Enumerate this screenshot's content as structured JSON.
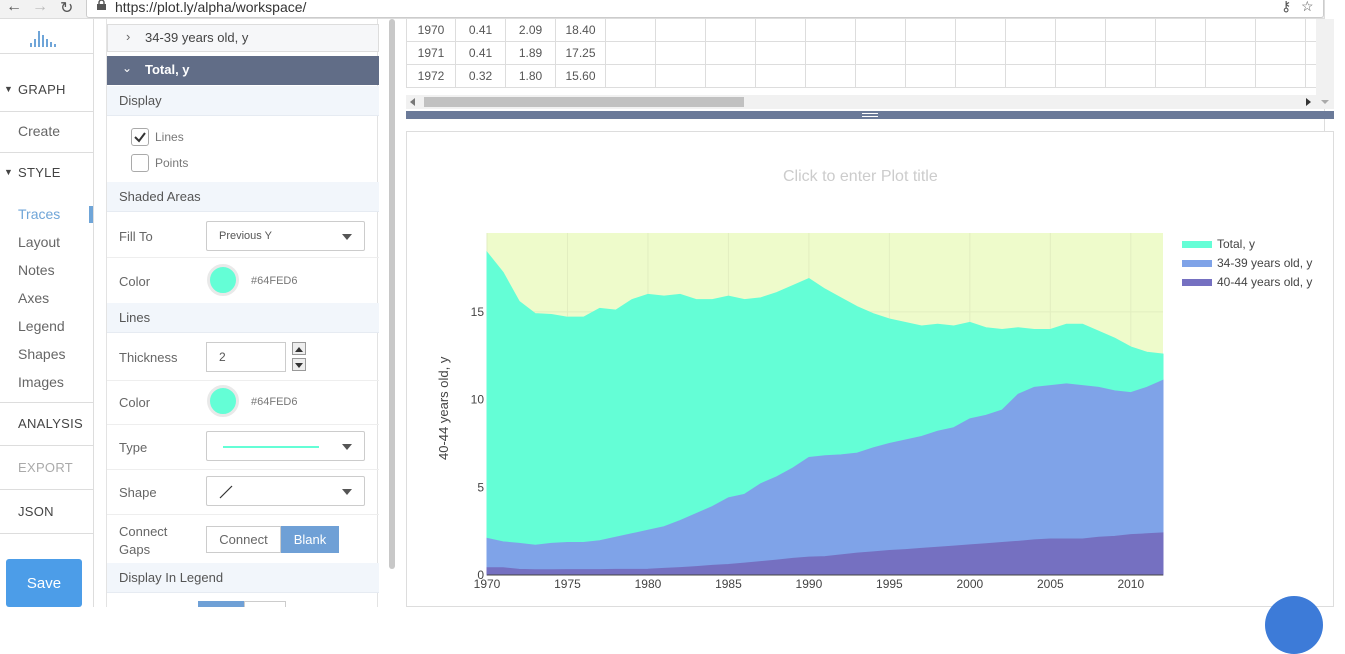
{
  "browser": {
    "url": "https://plot.ly/alpha/workspace/"
  },
  "leftnav": {
    "graph": "GRAPH",
    "create": "Create",
    "style": "STYLE",
    "style_items": [
      "Traces",
      "Layout",
      "Notes",
      "Axes",
      "Legend",
      "Shapes",
      "Images"
    ],
    "analysis": "ANALYSIS",
    "export": "EXPORT",
    "json": "JSON",
    "save": "Save"
  },
  "panel": {
    "collapsed_trace": "34-39 years old, y",
    "open_trace": "Total, y",
    "display": "Display",
    "lines_cb": "Lines",
    "points_cb": "Points",
    "shaded_areas": "Shaded Areas",
    "fill_to_label": "Fill To",
    "fill_to_value": "Previous Y",
    "color_label": "Color",
    "fill_color_hex": "#64FED6",
    "lines_section": "Lines",
    "thickness_label": "Thickness",
    "thickness_value": "2",
    "line_color_label": "Color",
    "line_color_hex": "#64FED6",
    "type_label": "Type",
    "shape_label": "Shape",
    "connect_gaps_label": "Connect Gaps",
    "connect": "Connect",
    "blank": "Blank",
    "display_in_legend": "Display In Legend"
  },
  "grid": {
    "rows": [
      [
        "1970",
        "0.41",
        "2.09",
        "18.40"
      ],
      [
        "1971",
        "0.41",
        "1.89",
        "17.25"
      ],
      [
        "1972",
        "0.32",
        "1.80",
        "15.60"
      ]
    ]
  },
  "colors": {
    "total": "#64FED6",
    "age3439": "#7FA3E8",
    "age4044": "#7570C1",
    "bg": "#EEFBCB"
  },
  "chart_data": {
    "type": "area",
    "title": "Click to enter Plot title",
    "ylabel": "40-44 years old, y",
    "xlim": [
      1970,
      2012
    ],
    "ylim": [
      0,
      19.5
    ],
    "x_ticks": [
      1970,
      1975,
      1980,
      1985,
      1990,
      1995,
      2000,
      2005,
      2010
    ],
    "y_ticks": [
      0,
      5,
      10,
      15
    ],
    "legend_position": "right",
    "x": [
      1970,
      1971,
      1972,
      1973,
      1974,
      1975,
      1976,
      1977,
      1978,
      1979,
      1980,
      1981,
      1982,
      1983,
      1984,
      1985,
      1986,
      1987,
      1988,
      1989,
      1990,
      1991,
      1992,
      1993,
      1994,
      1995,
      1996,
      1997,
      1998,
      1999,
      2000,
      2001,
      2002,
      2003,
      2004,
      2005,
      2006,
      2007,
      2008,
      2009,
      2010,
      2011,
      2012
    ],
    "series": [
      {
        "name": "Total, y",
        "values": [
          18.4,
          17.25,
          15.6,
          14.9,
          14.85,
          14.7,
          14.7,
          15.2,
          15.1,
          15.7,
          16.0,
          15.9,
          16.0,
          15.7,
          15.7,
          15.9,
          15.7,
          15.8,
          16.1,
          16.5,
          16.9,
          16.3,
          15.8,
          15.3,
          14.9,
          14.6,
          14.4,
          14.2,
          14.3,
          14.2,
          14.4,
          14.1,
          14.0,
          14.1,
          14.0,
          14.0,
          14.3,
          14.3,
          13.9,
          13.5,
          13.0,
          12.7,
          12.6
        ]
      },
      {
        "name": "34-39 years old, y",
        "values": [
          2.09,
          1.89,
          1.8,
          1.7,
          1.8,
          1.85,
          1.85,
          1.95,
          2.15,
          2.35,
          2.55,
          2.75,
          3.1,
          3.5,
          3.9,
          4.4,
          4.6,
          5.2,
          5.6,
          6.1,
          6.7,
          6.8,
          6.85,
          6.95,
          7.25,
          7.5,
          7.7,
          7.9,
          8.2,
          8.4,
          8.9,
          9.1,
          9.4,
          10.3,
          10.7,
          10.8,
          10.9,
          10.8,
          10.7,
          10.5,
          10.4,
          10.7,
          11.1
        ]
      },
      {
        "name": "40-44 years old, y",
        "values": [
          0.41,
          0.41,
          0.32,
          0.3,
          0.3,
          0.31,
          0.31,
          0.31,
          0.32,
          0.32,
          0.33,
          0.38,
          0.42,
          0.48,
          0.55,
          0.6,
          0.68,
          0.76,
          0.85,
          0.95,
          1.02,
          1.05,
          1.15,
          1.25,
          1.32,
          1.4,
          1.45,
          1.52,
          1.58,
          1.65,
          1.72,
          1.78,
          1.85,
          1.92,
          2.0,
          2.05,
          2.05,
          2.05,
          2.15,
          2.2,
          2.3,
          2.35,
          2.4
        ]
      }
    ]
  }
}
